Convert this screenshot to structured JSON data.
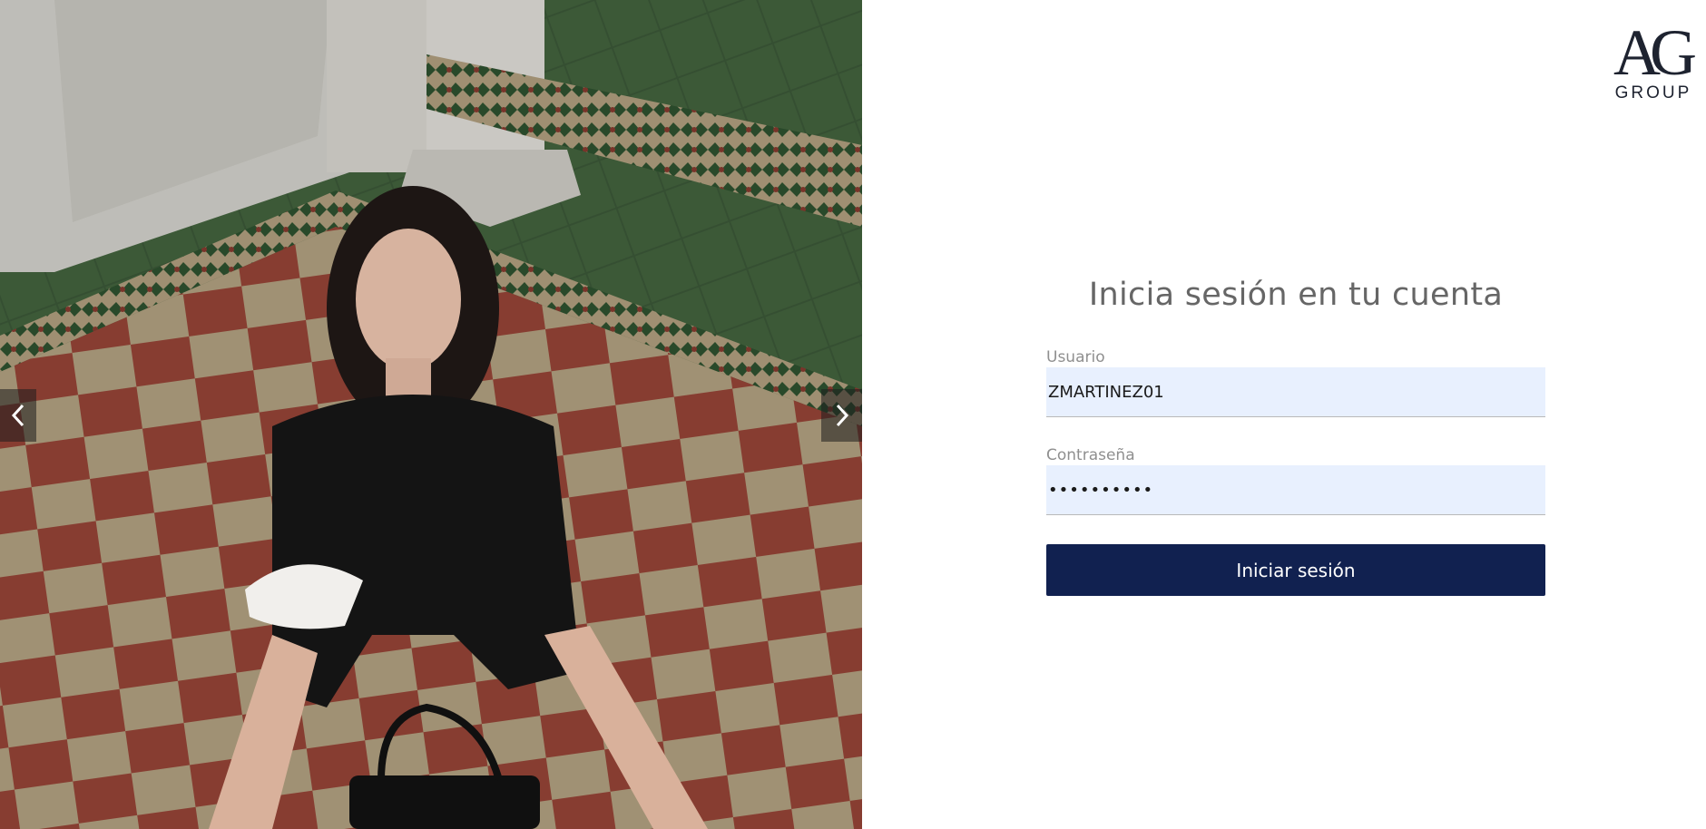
{
  "brand": {
    "logo_mark": "AG",
    "logo_text": "GROUP"
  },
  "carousel": {
    "prev_icon": "chevron-left-icon",
    "next_icon": "chevron-right-icon"
  },
  "login": {
    "title": "Inicia sesión en tu cuenta",
    "username_label": "Usuario",
    "username_value": "ZMARTINEZ01",
    "password_label": "Contraseña",
    "password_value": "••••••••••",
    "submit_label": "Iniciar sesión"
  },
  "colors": {
    "button_bg": "#112150",
    "input_bg": "#e8f0fe",
    "title_text": "#666666",
    "label_text": "#8f8f8f"
  }
}
